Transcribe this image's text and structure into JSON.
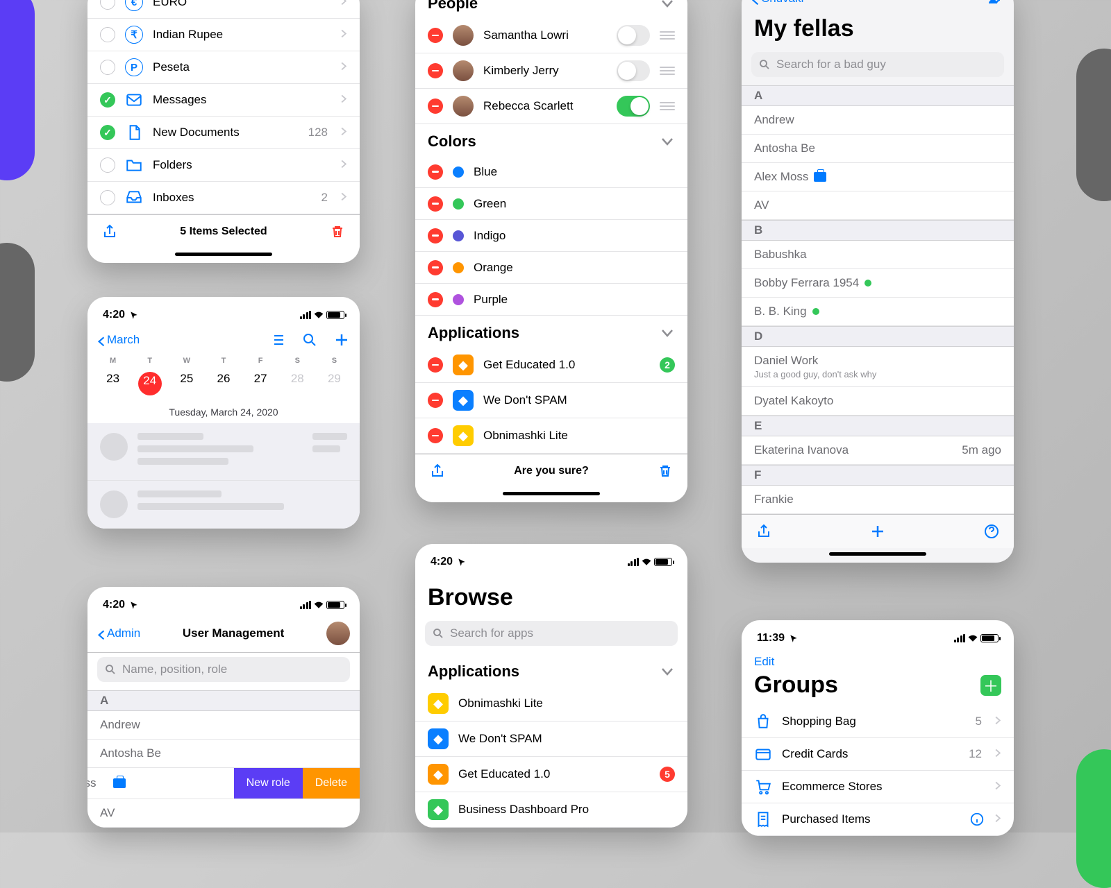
{
  "colors": {
    "blue": "#007aff",
    "green": "#34c759",
    "red": "#ff3b30",
    "orange": "#ff9500",
    "purple": "#5b3df5",
    "indigo": "#5856d6"
  },
  "status_time_1": "4:20",
  "status_time_2": "11:39",
  "panel_items": {
    "selection_status": "5 Items Selected",
    "currencies": [
      {
        "symbol": "€",
        "label": "EURO"
      },
      {
        "symbol": "₹",
        "label": "Indian Rupee"
      },
      {
        "symbol": "P",
        "label": "Peseta"
      }
    ],
    "features": [
      {
        "icon": "mail",
        "label": "Messages",
        "checked": true,
        "badge": "",
        "disclosure": true
      },
      {
        "icon": "doc",
        "label": "New Documents",
        "checked": true,
        "badge": "128",
        "disclosure": true
      },
      {
        "icon": "folder",
        "label": "Folders",
        "checked": false,
        "badge": "",
        "disclosure": true
      },
      {
        "icon": "inbox",
        "label": "Inboxes",
        "checked": false,
        "badge": "2",
        "disclosure": true
      }
    ]
  },
  "panel_edit": {
    "footer_prompt": "Are you sure?",
    "sections": {
      "people": {
        "title": "People",
        "items": [
          {
            "name": "Samantha Lowri",
            "on": false
          },
          {
            "name": "Kimberly Jerry",
            "on": false
          },
          {
            "name": "Rebecca Scarlett",
            "on": true
          }
        ]
      },
      "colors": {
        "title": "Colors",
        "items": [
          {
            "label": "Blue",
            "hex": "#0a7fff"
          },
          {
            "label": "Green",
            "hex": "#34c759"
          },
          {
            "label": "Indigo",
            "hex": "#5856d6"
          },
          {
            "label": "Orange",
            "hex": "#ff9500"
          },
          {
            "label": "Purple",
            "hex": "#af52de"
          }
        ]
      },
      "apps": {
        "title": "Applications",
        "items": [
          {
            "label": "Get Educated 1.0",
            "color": "#ff9500",
            "badge": "2"
          },
          {
            "label": "We Don't SPAM",
            "color": "#0a7fff"
          },
          {
            "label": "Obnimashki Lite",
            "color": "#ffcc00"
          }
        ]
      }
    }
  },
  "panel_contacts": {
    "back": "Chuvaki",
    "title": "My fellas",
    "search_ph": "Search for a bad guy",
    "groups": [
      {
        "letter": "A",
        "items": [
          {
            "name": "Andrew"
          },
          {
            "name": "Antosha Be"
          },
          {
            "name": "Alex Moss",
            "briefcase": true
          },
          {
            "name": "AV"
          }
        ]
      },
      {
        "letter": "B",
        "items": [
          {
            "name": "Babushka"
          },
          {
            "name": "Bobby Ferrara 1954",
            "presence": true
          },
          {
            "name": "B. B. King",
            "presence": true
          }
        ]
      },
      {
        "letter": "D",
        "items": [
          {
            "name": "Daniel Work",
            "sub": "Just a good guy, don't ask why"
          },
          {
            "name": "Dyatel Kakoyto"
          }
        ]
      },
      {
        "letter": "E",
        "items": [
          {
            "name": "Ekaterina Ivanova",
            "meta": "5m ago"
          }
        ]
      },
      {
        "letter": "F",
        "items": [
          {
            "name": "Frankie"
          }
        ]
      }
    ]
  },
  "panel_calendar": {
    "back": "March",
    "weekdays": [
      "M",
      "T",
      "W",
      "T",
      "F",
      "S",
      "S"
    ],
    "dates": [
      23,
      24,
      25,
      26,
      27,
      28,
      29
    ],
    "today": 24,
    "caption": "Tuesday, March 24, 2020"
  },
  "panel_admin": {
    "back": "Admin",
    "title": "User Management",
    "search_ph": "Name, position, role",
    "swipe_new_role": "New role",
    "swipe_delete": "Delete",
    "groups": [
      {
        "letter": "A",
        "items": [
          {
            "name": "Andrew"
          },
          {
            "name": "Antosha Be"
          }
        ]
      },
      {
        "letter": "",
        "swipe_row": "oss"
      },
      {
        "letter": "",
        "items": [
          {
            "name": "AV"
          }
        ]
      }
    ]
  },
  "panel_browse": {
    "title": "Browse",
    "search_ph": "Search for apps",
    "section_title": "Applications",
    "apps": [
      {
        "label": "Obnimashki Lite",
        "color": "#ffcc00"
      },
      {
        "label": "We Don't SPAM",
        "color": "#0a7fff"
      },
      {
        "label": "Get Educated 1.0",
        "color": "#ff9500",
        "badge": "5"
      },
      {
        "label": "Business Dashboard Pro",
        "color": "#34c759"
      }
    ]
  },
  "panel_groups": {
    "edit": "Edit",
    "title": "Groups",
    "items": [
      {
        "icon": "bag",
        "label": "Shopping Bag",
        "count": "5"
      },
      {
        "icon": "card",
        "label": "Credit Cards",
        "count": "12"
      },
      {
        "icon": "cart",
        "label": "Ecommerce Stores"
      },
      {
        "icon": "receipt",
        "label": "Purchased Items",
        "info": true
      }
    ]
  }
}
